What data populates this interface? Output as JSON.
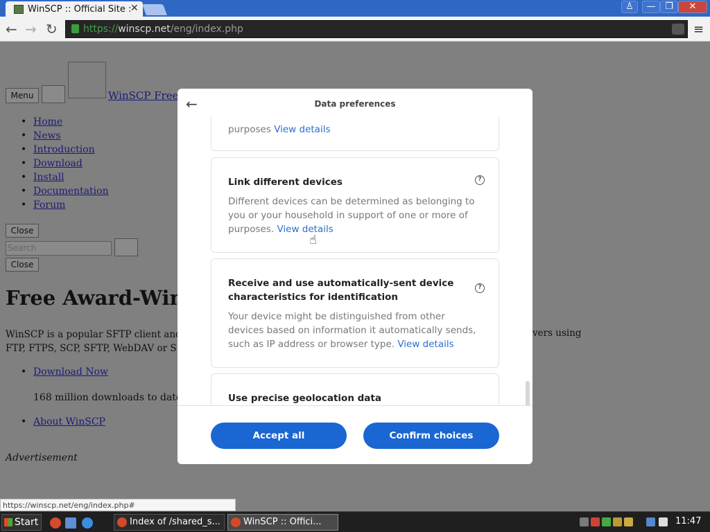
{
  "browser": {
    "tab_title": "WinSCP :: Official Site ::",
    "tab_close": "✕",
    "url_scheme": "https://",
    "url_host": "winscp.net",
    "url_path": "/eng/index.php",
    "window_controls": {
      "user": "♙",
      "minimize": "—",
      "restore": "❐",
      "close": "✕"
    },
    "back": "←",
    "forward": "→",
    "reload": "↻",
    "menu": "≡"
  },
  "page": {
    "menu_button": "Menu",
    "site_link": "WinSCP Free S",
    "nav": [
      "Home",
      "News",
      "Introduction",
      "Download",
      "Install",
      "Documentation",
      "Forum"
    ],
    "close_label": "Close",
    "search_placeholder": "Search",
    "heading": "Free Award-Winn",
    "para_line1": "WinSCP is a popular SFTP client and FT",
    "para_line2": "FTP, FTPS, SCP, SFTP, WebDAV or S",
    "para_right": "vers using",
    "download_link": "Download Now",
    "downloads_text": "168 million downloads to date",
    "about_link": "About WinSCP",
    "advertisement": "Advertisement"
  },
  "status_url": "https://winscp.net/eng/index.php#",
  "modal": {
    "back_icon": "←",
    "title": "Data preferences",
    "cards": [
      {
        "title": "",
        "desc_start": "y",
        "desc_tail": "purposes",
        "link": "View details"
      },
      {
        "title": "Link different devices",
        "desc": "Different devices can be determined as belonging to you or your household in support of one or more of purposes.",
        "link": "View details",
        "help": "?"
      },
      {
        "title": "Receive and use automatically-sent device characteristics for identification",
        "desc": "Your device might be distinguished from other devices based on information it automatically sends, such as IP address or browser type.",
        "link": "View details",
        "help": "?"
      },
      {
        "title": "Use precise geolocation data"
      }
    ],
    "accept_all": "Accept all",
    "confirm_choices": "Confirm choices"
  },
  "taskbar": {
    "start": "Start",
    "tasks": [
      "Index of /shared_s...",
      "WinSCP :: Offici..."
    ],
    "clock": "11:47"
  }
}
